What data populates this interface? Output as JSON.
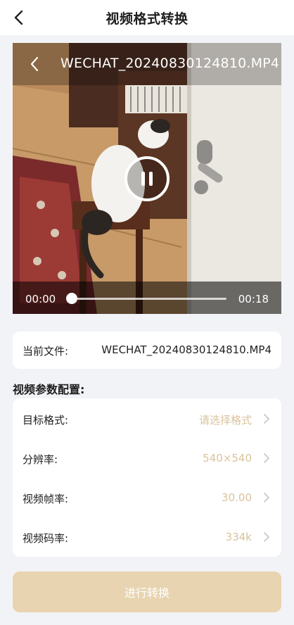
{
  "header": {
    "title": "视频格式转换"
  },
  "video": {
    "filename": "WECHAT_20240830124810.MP4",
    "current_time": "00:00",
    "duration": "00:18",
    "progress": 0.0,
    "state": "playing"
  },
  "file_info": {
    "label": "当前文件:",
    "value": "WECHAT_20240830124810.MP4"
  },
  "config": {
    "section_title": "视频参数配置:",
    "rows": [
      {
        "label": "目标格式:",
        "value": "请选择格式"
      },
      {
        "label": "分辨率:",
        "value": "540×540"
      },
      {
        "label": "视频帧率:",
        "value": "30.00"
      },
      {
        "label": "视频码率:",
        "value": "334k"
      }
    ]
  },
  "actions": {
    "convert_label": "进行转换"
  },
  "colors": {
    "accent_value": "#d9c39c",
    "button_bg": "#e8d4b0",
    "page_bg": "#f2f3f7"
  }
}
